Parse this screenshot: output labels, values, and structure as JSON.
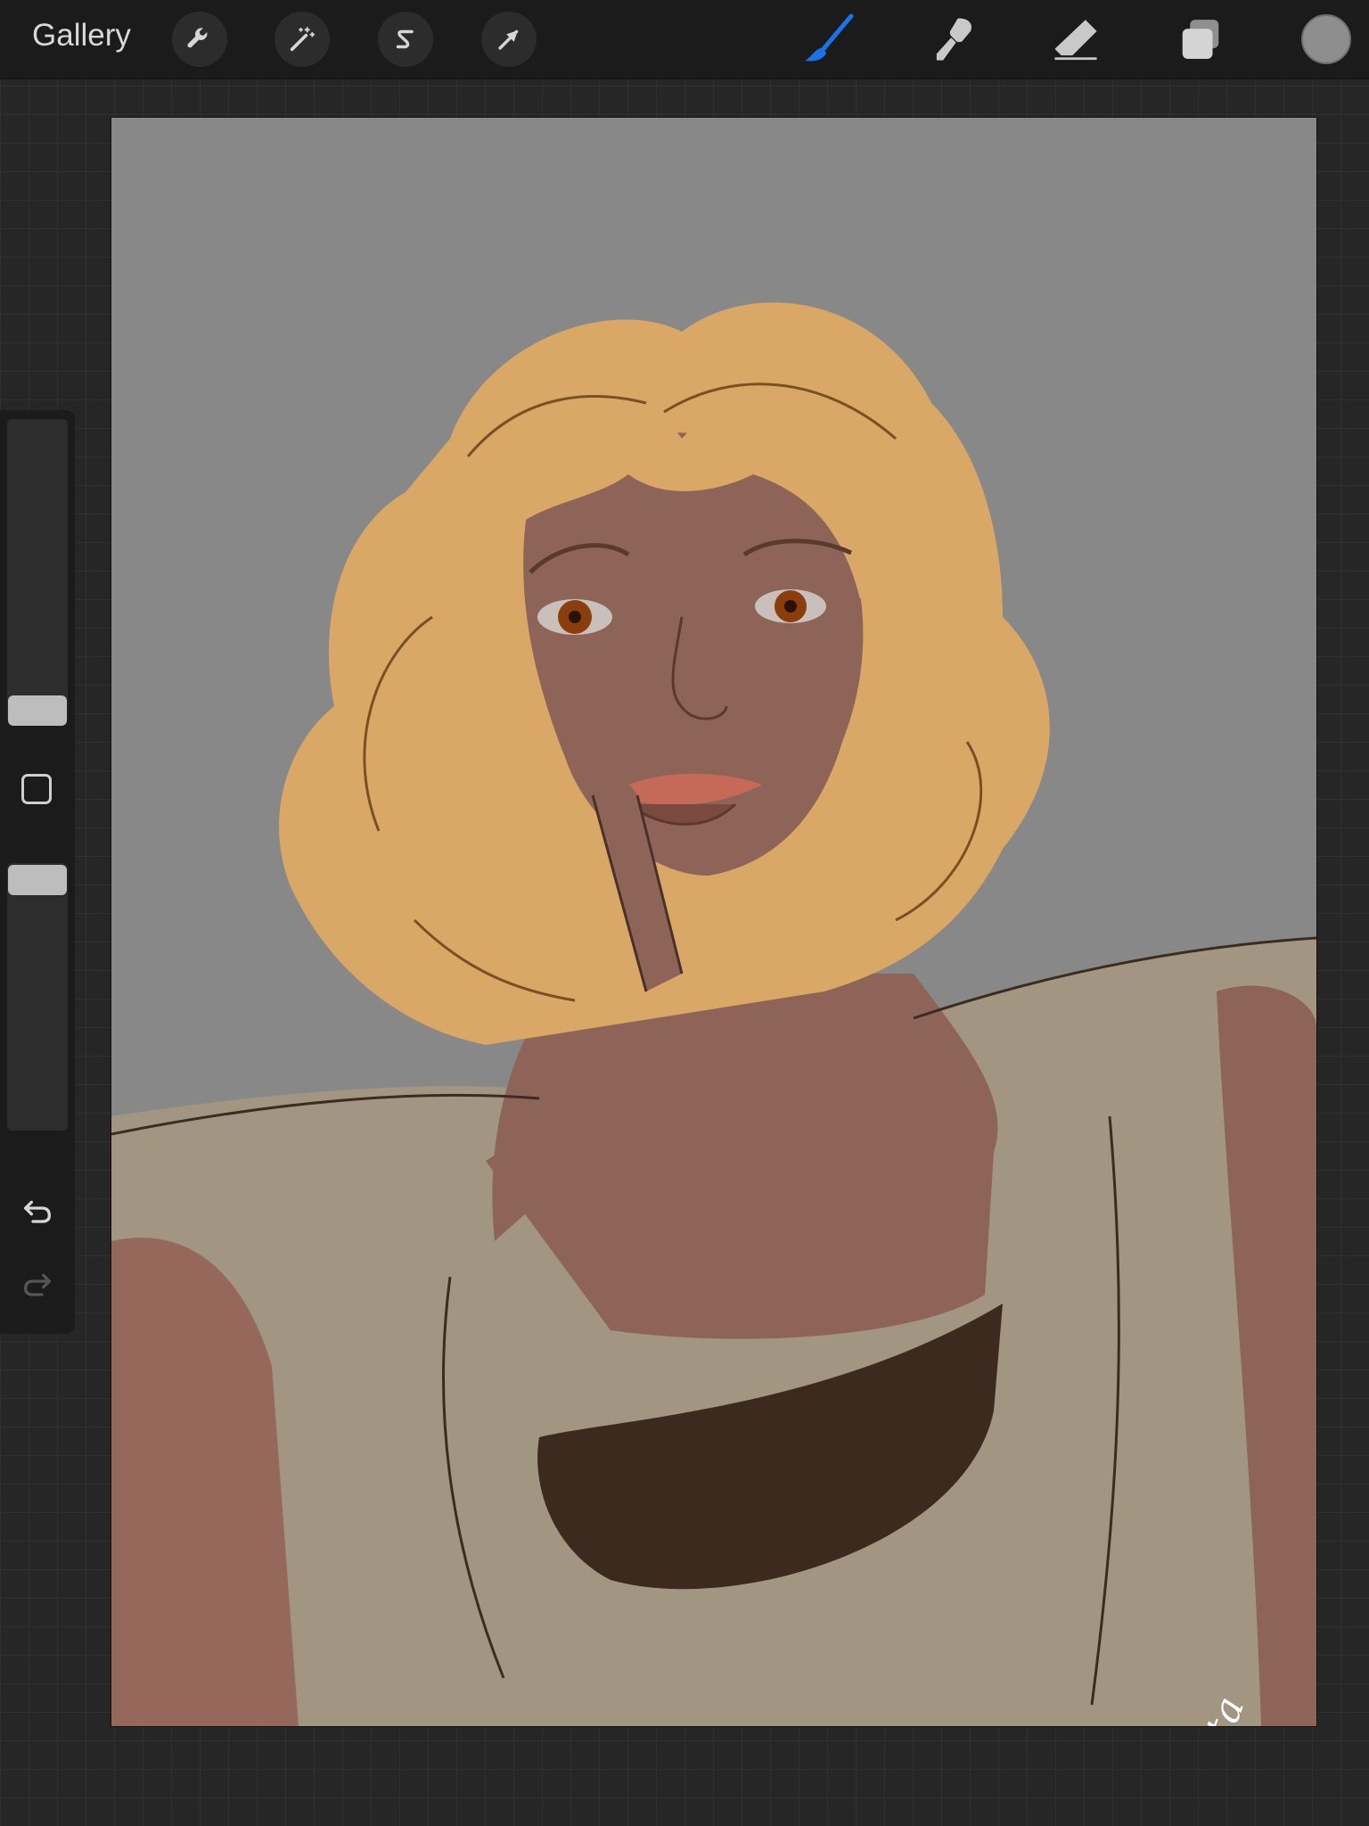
{
  "topbar": {
    "gallery_label": "Gallery",
    "left_tools": [
      {
        "name": "wrench-icon",
        "label": "Actions"
      },
      {
        "name": "magic-wand-icon",
        "label": "Adjustments"
      },
      {
        "name": "selection-s-icon",
        "label": "Selection"
      },
      {
        "name": "arrow-cursor-icon",
        "label": "Transform"
      }
    ],
    "right_tools": [
      {
        "name": "brush-icon",
        "label": "Paint",
        "active": true,
        "color": "#1a74e8"
      },
      {
        "name": "smudge-icon",
        "label": "Smudge",
        "active": false
      },
      {
        "name": "eraser-icon",
        "label": "Erase",
        "active": false
      },
      {
        "name": "layers-icon",
        "label": "Layers",
        "active": false
      }
    ],
    "current_color": "#8e8e8e"
  },
  "sidebar": {
    "brush_size_level": 0.35,
    "opacity_level": 0.2,
    "undo_icon": "undo-icon",
    "redo_icon": "redo-icon",
    "redo_enabled": false
  },
  "canvas": {
    "background_color": "#888889",
    "signature_text": "Sinthwista"
  },
  "colors": {
    "app_background": "#262627",
    "toolbar": "#1b1b1c",
    "hair": "#d9a866",
    "skin": "#8e6458",
    "sweater": "#a29683",
    "top": "#3d2a1e",
    "lips": "#c56a57",
    "eyes": "#8a3e0d"
  }
}
